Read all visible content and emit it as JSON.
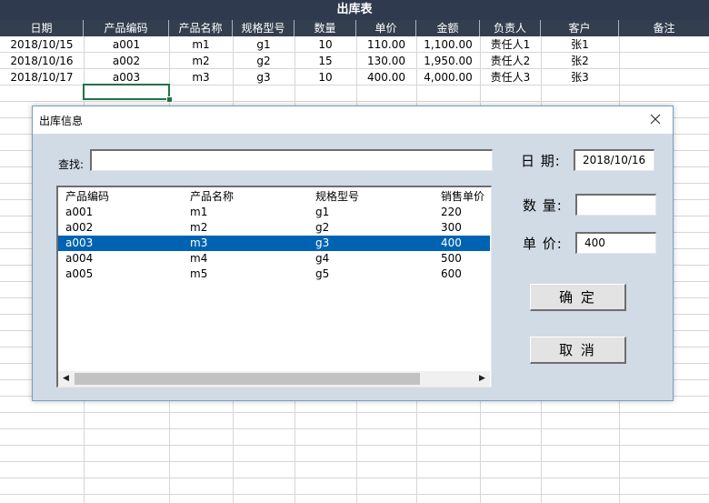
{
  "sheet": {
    "title": "出库表",
    "headers": [
      "日期",
      "产品编码",
      "产品名称",
      "规格型号",
      "数量",
      "单价",
      "金额",
      "负责人",
      "客户",
      "备注"
    ],
    "rows": [
      [
        "2018/10/15",
        "a001",
        "m1",
        "g1",
        "10",
        "110.00",
        "1,100.00",
        "责任人1",
        "张1",
        ""
      ],
      [
        "2018/10/16",
        "a002",
        "m2",
        "g2",
        "15",
        "130.00",
        "1,950.00",
        "责任人2",
        "张2",
        ""
      ],
      [
        "2018/10/17",
        "a003",
        "m3",
        "g3",
        "10",
        "400.00",
        "4,000.00",
        "责任人3",
        "张3",
        ""
      ]
    ]
  },
  "dialog": {
    "title": "出库信息",
    "close_icon": "close-icon",
    "search_label": "查找:",
    "search_value": "",
    "date_label": "日 期:",
    "date_value": "2018/10/16",
    "qty_label": "数 量:",
    "qty_value": "",
    "price_label": "单 价:",
    "price_value": "400",
    "list": {
      "headers": [
        "产品编码",
        "产品名称",
        "规格型号",
        "销售单价"
      ],
      "rows": [
        [
          "a001",
          "m1",
          "g1",
          "220"
        ],
        [
          "a002",
          "m2",
          "g2",
          "300"
        ],
        [
          "a003",
          "m3",
          "g3",
          "400"
        ],
        [
          "a004",
          "m4",
          "g4",
          "500"
        ],
        [
          "a005",
          "m5",
          "g5",
          "600"
        ]
      ],
      "selected_index": 2
    },
    "confirm_label": "确 定",
    "cancel_label": "取 消"
  },
  "colors": {
    "sheet_header_bg": "#333f4f",
    "dialog_bg": "#d1dbe6",
    "selection_bg": "#0063b1",
    "active_cell_border": "#217346"
  }
}
